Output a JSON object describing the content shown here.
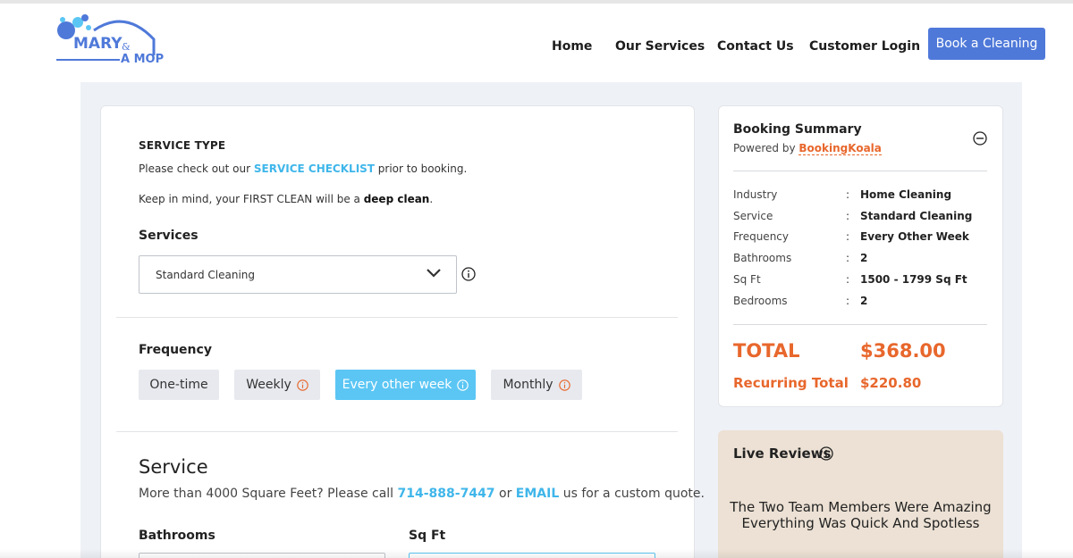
{
  "brand": {
    "logo_text_1": "MARY",
    "logo_amp": "&",
    "logo_text_2": "A MOP",
    "color_primary": "#4f79d9",
    "color_accent": "#3fb6ea",
    "color_orange": "#e8672c"
  },
  "nav": {
    "home": "Home",
    "services": "Our Services",
    "contact": "Contact Us",
    "login": "Customer Login",
    "book": "Book a Cleaning"
  },
  "form": {
    "service_type_label": "SERVICE TYPE",
    "checklist_prefix": "Please check out our ",
    "checklist_link": "SERVICE CHECKLIST",
    "checklist_suffix": " prior to booking.",
    "first_clean_prefix": "Keep in mind, your FIRST CLEAN will be a ",
    "first_clean_bold": "deep clean",
    "first_clean_suffix": ".",
    "services_label": "Services",
    "services_selected": "Standard Cleaning",
    "frequency_label": "Frequency",
    "frequency_options": [
      {
        "label": "One-time",
        "active": false,
        "info": false
      },
      {
        "label": "Weekly",
        "active": false,
        "info": true
      },
      {
        "label": "Every other week",
        "active": true,
        "info": true
      },
      {
        "label": "Monthly",
        "active": false,
        "info": true
      }
    ],
    "service_heading": "Service",
    "more_prefix": "More than 4000 Square Feet? Please call ",
    "phone": "714-888-7447",
    "more_or": " or ",
    "email_link": "EMAIL",
    "more_suffix": " us for a custom quote.",
    "bathrooms_label": "Bathrooms",
    "sqft_label": "Sq Ft"
  },
  "summary": {
    "title": "Booking Summary",
    "powered_prefix": "Powered by ",
    "powered_link": "BookingKoala",
    "rows": [
      {
        "label": "Industry",
        "value": "Home Cleaning"
      },
      {
        "label": "Service",
        "value": "Standard Cleaning"
      },
      {
        "label": "Frequency",
        "value": "Every Other Week"
      },
      {
        "label": "Bathrooms",
        "value": "2"
      },
      {
        "label": "Sq Ft",
        "value": "1500 - 1799 Sq Ft"
      },
      {
        "label": "Bedrooms",
        "value": "2"
      }
    ],
    "colon": ":",
    "total_label": "TOTAL",
    "total_value": "$368.00",
    "recurring_label": "Recurring Total",
    "recurring_value": "$220.80"
  },
  "reviews": {
    "title": "Live Reviews",
    "text": "The Two Team Members Were Amazing Everything Was Quick And Spotless"
  }
}
